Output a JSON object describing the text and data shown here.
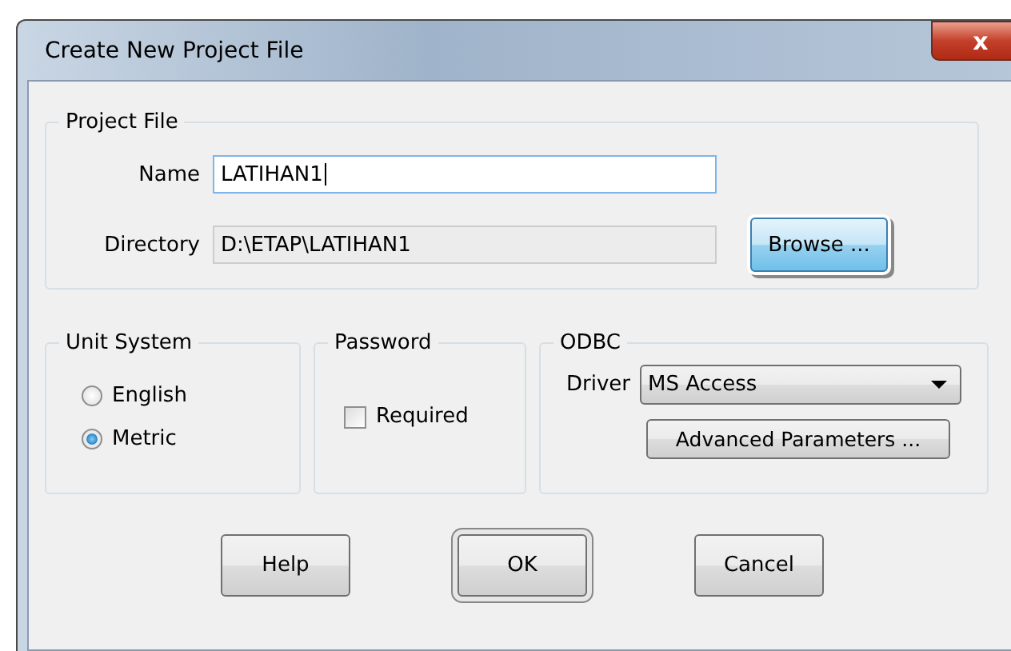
{
  "window": {
    "title": "Create New Project File",
    "close": "x"
  },
  "project_file": {
    "title": "Project File",
    "name_label": "Name",
    "name_value": "LATIHAN1",
    "directory_label": "Directory",
    "directory_value": "D:\\ETAP\\LATIHAN1",
    "browse": {
      "label": "Browse ...",
      "focused": true
    }
  },
  "unit_system": {
    "title": "Unit System",
    "options": [
      {
        "label": "English",
        "selected": false
      },
      {
        "label": "Metric",
        "selected": true
      }
    ]
  },
  "password": {
    "title": "Password",
    "required": {
      "label": "Required",
      "checked": false
    }
  },
  "odbc": {
    "title": "ODBC",
    "driver_label": "Driver",
    "driver_value": "MS Access",
    "advanced": "Advanced Parameters ..."
  },
  "buttons": [
    {
      "label": "Help",
      "default": false
    },
    {
      "label": "OK",
      "default": true
    },
    {
      "label": "Cancel",
      "default": false
    }
  ]
}
